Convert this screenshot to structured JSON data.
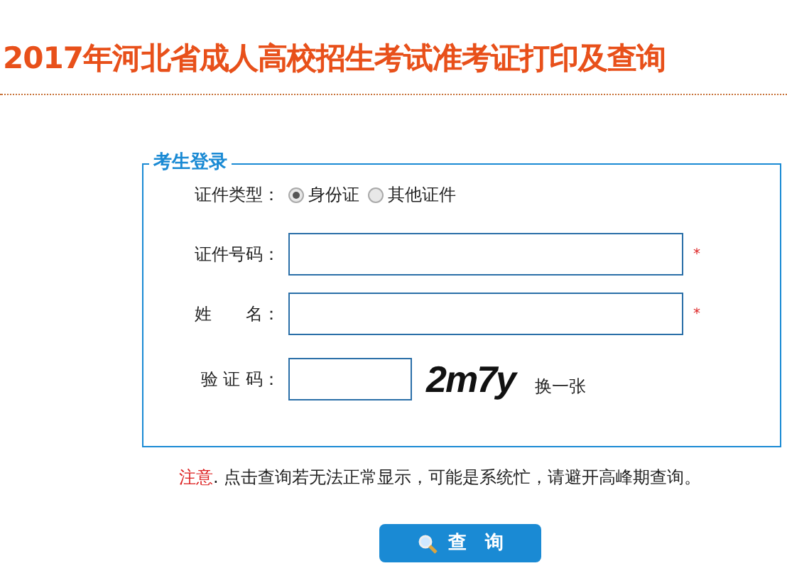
{
  "title": "2017年河北省成人高校招生考试准考证打印及查询",
  "login": {
    "legend": "考生登录",
    "id_type": {
      "label": "证件类型：",
      "options": [
        {
          "label": "身份证",
          "selected": true
        },
        {
          "label": "其他证件",
          "selected": false
        }
      ]
    },
    "fields": [
      {
        "label": "证件号码：",
        "required_mark": "*"
      },
      {
        "label": "姓　　名：",
        "required_mark": "*"
      }
    ],
    "captcha": {
      "label": "验 证 码：",
      "code": "2m7y",
      "refresh": "换一张"
    }
  },
  "note": {
    "label": "注意",
    "text": ". 点击查询若无法正常显示，可能是系统忙，请避开高峰期查询。"
  },
  "submit": "查　询"
}
